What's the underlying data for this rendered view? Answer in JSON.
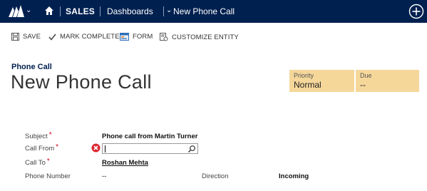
{
  "nav": {
    "app": "SALES",
    "area": "Dashboards",
    "record": "New Phone Call"
  },
  "commands": {
    "save": "SAVE",
    "mark_complete": "MARK COMPLETE",
    "form": "FORM",
    "customize": "CUSTOMIZE ENTITY"
  },
  "header": {
    "entity": "Phone Call",
    "title": "New Phone Call",
    "priority_label": "Priority",
    "priority_value": "Normal",
    "due_label": "Due",
    "due_value": "--"
  },
  "form": {
    "subject_label": "Subject",
    "subject_value": "Phone call from Martin Turner",
    "call_from_label": "Call From",
    "call_from_value": "",
    "call_to_label": "Call To",
    "call_to_value": "Roshan Mehta",
    "phone_label": "Phone Number",
    "phone_value": "--",
    "direction_label": "Direction",
    "direction_value": "Incoming",
    "required_mark": "*"
  },
  "colors": {
    "nav_bg": "#002050",
    "header_field_bg": "#f5d79a",
    "required": "#d0021b",
    "error": "#d9272e"
  },
  "icons": [
    "dynamics-logo-icon",
    "chevron-down-icon",
    "home-icon",
    "plus-circle-icon",
    "save-icon",
    "checkmark-icon",
    "form-icon",
    "customize-icon",
    "error-icon",
    "lookup-search-icon"
  ]
}
